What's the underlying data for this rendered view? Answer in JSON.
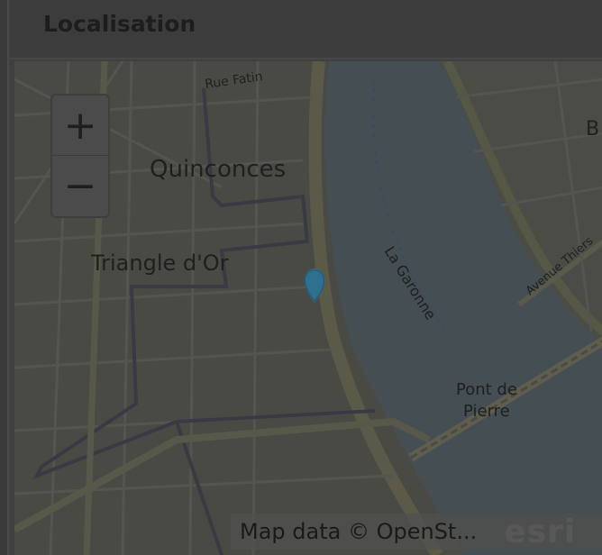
{
  "panel": {
    "title": "Localisation"
  },
  "map": {
    "zoom_in_label": "+",
    "zoom_out_label": "−",
    "labels": {
      "rue_fatin": "Rue Fatin",
      "quinconces": "Quinconces",
      "triangle": "Triangle d'Or",
      "garonne": "La Garonne",
      "pont_line1": "Pont de",
      "pont_line2": "Pierre",
      "avenue": "Avenue Thiers",
      "corner_letter": "B"
    },
    "attribution": "Map data © OpenSt...",
    "logo": "esri",
    "colors": {
      "water": "#454e52",
      "land": "#4a4a45",
      "road": "#5a5a4c",
      "marker": "#2f6f8f"
    }
  }
}
